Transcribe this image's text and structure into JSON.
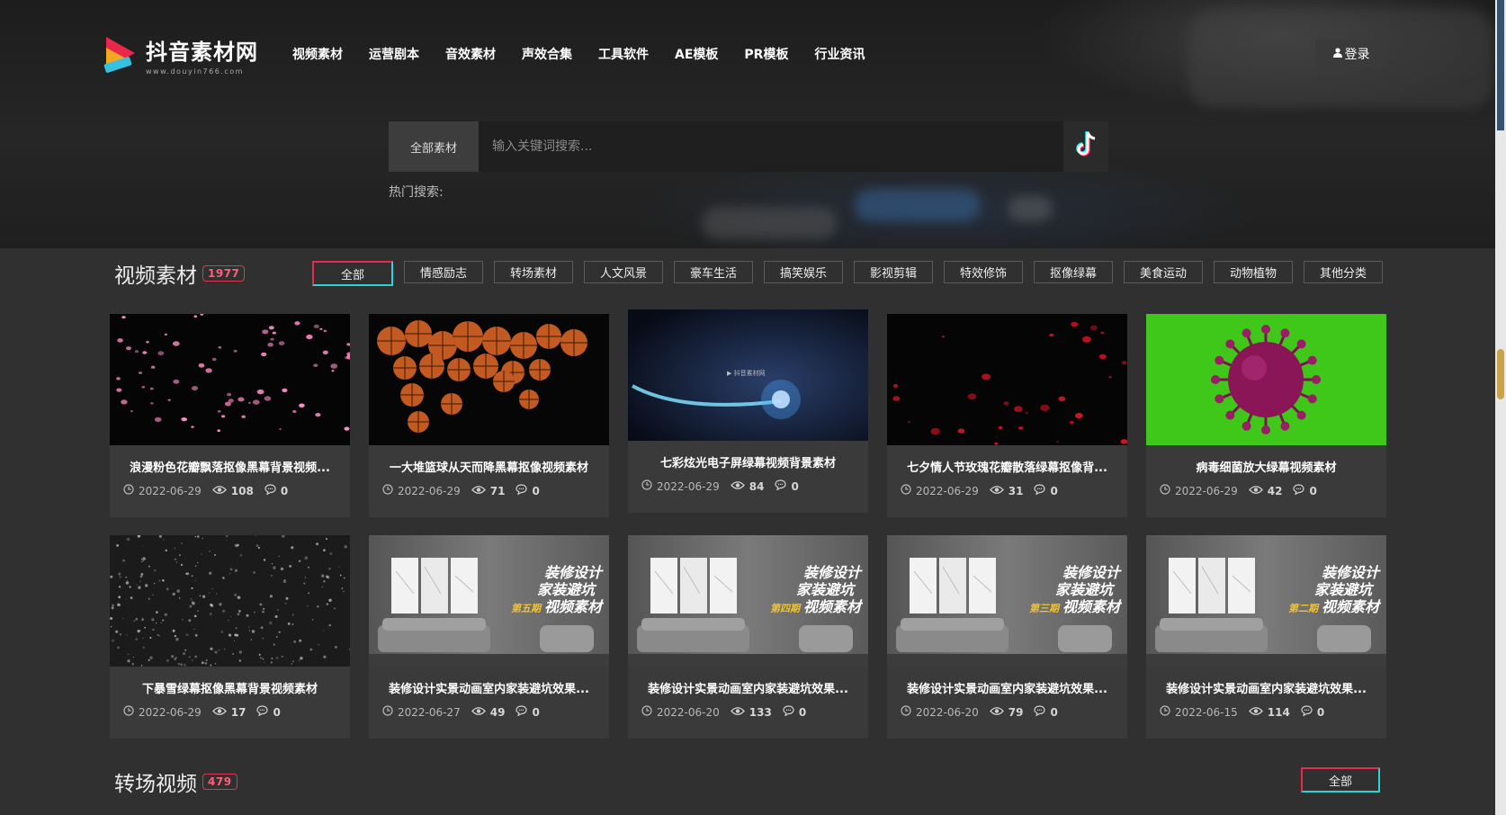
{
  "header": {
    "logo_title": "抖音素材网",
    "logo_sub": "www.douyin766.com",
    "nav": [
      "视频素材",
      "运营剧本",
      "音效素材",
      "声效合集",
      "工具软件",
      "AE模板",
      "PR模板",
      "行业资讯"
    ],
    "login_label": "登录"
  },
  "search": {
    "category": "全部素材",
    "placeholder": "输入关键词搜索...",
    "hot_label": "热门搜索:"
  },
  "section1": {
    "title": "视频素材",
    "count": "1977",
    "filters": [
      "全部",
      "情感励志",
      "转场素材",
      "人文风景",
      "豪车生活",
      "搞笑娱乐",
      "影视剪辑",
      "特效修饰",
      "抠像绿幕",
      "美食运动",
      "动物植物",
      "其他分类"
    ],
    "active_filter": "全部",
    "cards": [
      {
        "title": "浪漫粉色花瓣飘落抠像黑幕背景视频...",
        "date": "2022-06-29",
        "views": "108",
        "comments": "0",
        "thumb": "petals-pink"
      },
      {
        "title": "一大堆篮球从天而降黑幕抠像视频素材",
        "date": "2022-06-29",
        "views": "71",
        "comments": "0",
        "thumb": "basketballs"
      },
      {
        "title": "七彩炫光电子屏绿幕视频背景素材",
        "date": "2022-06-29",
        "views": "84",
        "comments": "0",
        "thumb": "light-streak"
      },
      {
        "title": "七夕情人节玫瑰花瓣散落绿幕抠像背...",
        "date": "2022-06-29",
        "views": "31",
        "comments": "0",
        "thumb": "petals-red"
      },
      {
        "title": "病毒细菌放大绿幕视频素材",
        "date": "2022-06-29",
        "views": "42",
        "comments": "0",
        "thumb": "virus"
      },
      {
        "title": "下暴雪绿幕抠像黑幕背景视频素材",
        "date": "2022-06-29",
        "views": "17",
        "comments": "0",
        "thumb": "snow"
      },
      {
        "title": "装修设计实景动画室内家装避坑效果...",
        "date": "2022-06-27",
        "views": "49",
        "comments": "0",
        "thumb": "interior",
        "overlay": [
          "装修设计",
          "家装避坑",
          "第五期",
          "视频素材"
        ]
      },
      {
        "title": "装修设计实景动画室内家装避坑效果...",
        "date": "2022-06-20",
        "views": "133",
        "comments": "0",
        "thumb": "interior",
        "overlay": [
          "装修设计",
          "家装避坑",
          "第四期",
          "视频素材"
        ]
      },
      {
        "title": "装修设计实景动画室内家装避坑效果...",
        "date": "2022-06-20",
        "views": "79",
        "comments": "0",
        "thumb": "interior",
        "overlay": [
          "装修设计",
          "家装避坑",
          "第三期",
          "视频素材"
        ]
      },
      {
        "title": "装修设计实景动画室内家装避坑效果...",
        "date": "2022-06-15",
        "views": "114",
        "comments": "0",
        "thumb": "interior",
        "overlay": [
          "装修设计",
          "家装避坑",
          "第二期",
          "视频素材"
        ]
      }
    ]
  },
  "section2": {
    "title": "转场视频",
    "count": "479",
    "all_label": "全部"
  },
  "colors": {
    "accent_red": "#e62b4d",
    "accent_cyan": "#2fd3d6",
    "green_screen": "#3fc81a"
  }
}
